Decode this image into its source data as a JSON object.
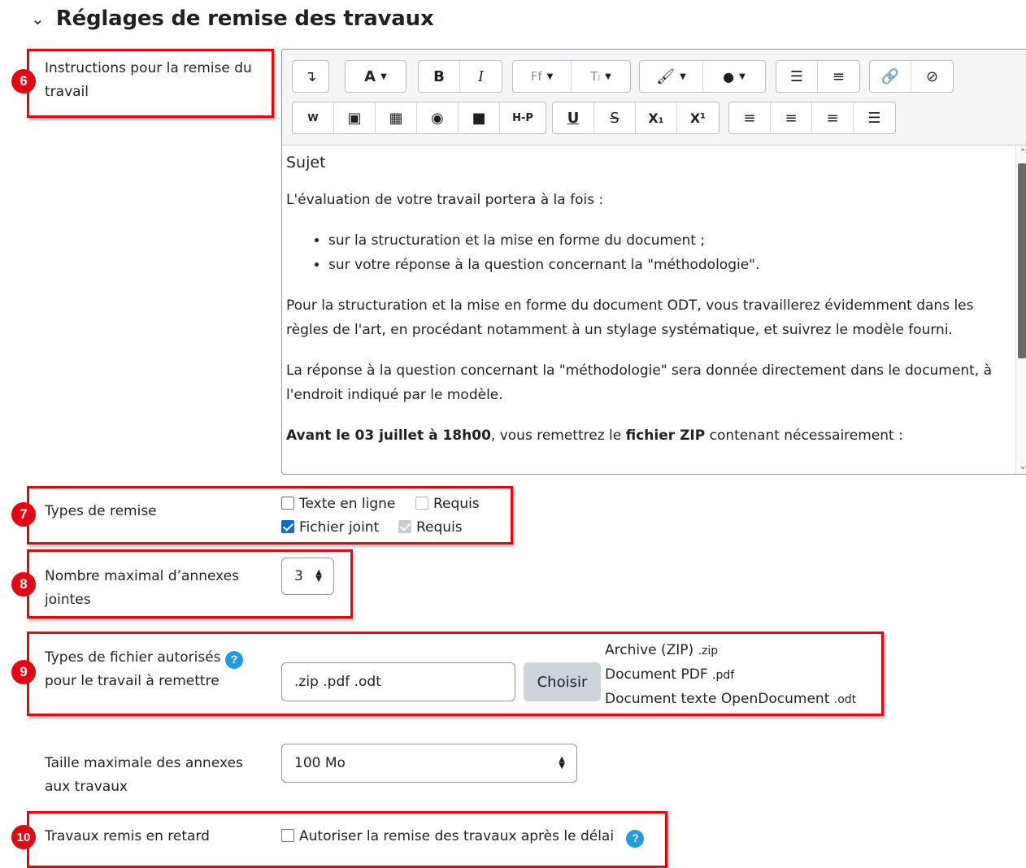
{
  "section": {
    "chevron_icon": "chevron-down-icon",
    "title": "Réglages de remise des travaux"
  },
  "markers": [
    "6",
    "7",
    "8",
    "9",
    "10"
  ],
  "instructions": {
    "label_line1": "Instructions pour la remise du",
    "label_line2": "travail",
    "toolbar": {
      "font_label": "A",
      "bold": "B",
      "italic": "I",
      "font_family": "Ff",
      "font_size": "Tᵢ",
      "h5p": "H-P",
      "underline": "U",
      "strike": "S",
      "subscript": "X₁",
      "superscript": "X¹"
    },
    "content": {
      "subject": "Sujet",
      "p1": "L'évaluation de votre travail portera à la fois :",
      "bullets": [
        "sur la structuration et la mise en forme du document ;",
        "sur votre réponse à la question concernant la \"méthodologie\"."
      ],
      "p2": "Pour la structuration et la mise en forme du document ODT, vous travaillerez évidemment dans les règles de l'art, en procédant notamment à un stylage systématique, et suivrez le modèle fourni.",
      "p3": "La réponse à la question concernant la \"méthodologie\" sera donnée directement dans le document, à l'endroit indiqué par le modèle.",
      "p4_bold1": "Avant le 03 juillet à 18h00",
      "p4_mid": ", vous remettrez le ",
      "p4_bold2": "fichier ZIP",
      "p4_end": " contenant nécessairement :"
    }
  },
  "submission_types": {
    "label": "Types de remise",
    "online_text": "Texte en ligne",
    "online_required": "Requis",
    "file": "Fichier joint",
    "file_required": "Requis"
  },
  "max_files": {
    "label_line1": "Nombre maximal d’annexes",
    "label_line2": "jointes",
    "value": "3"
  },
  "file_types": {
    "label_line1": "Types de fichier autorisés",
    "label_line2": "pour le travail à remettre",
    "value": ".zip .pdf .odt",
    "choose_button": "Choisir",
    "list": [
      {
        "name": "Archive (ZIP)",
        "ext": ".zip"
      },
      {
        "name": "Document PDF",
        "ext": ".pdf"
      },
      {
        "name": "Document texte OpenDocument",
        "ext": ".odt"
      }
    ]
  },
  "max_size": {
    "label_line1": "Taille maximale des annexes",
    "label_line2": "aux travaux",
    "value": "100 Mo"
  },
  "late": {
    "label": "Travaux remis en retard",
    "checkbox_label": "Autoriser la remise des travaux après le délai"
  },
  "colors": {
    "annotation_red": "#e30613",
    "accent_blue": "#0f6cbf",
    "help_blue": "#1f9bde"
  }
}
